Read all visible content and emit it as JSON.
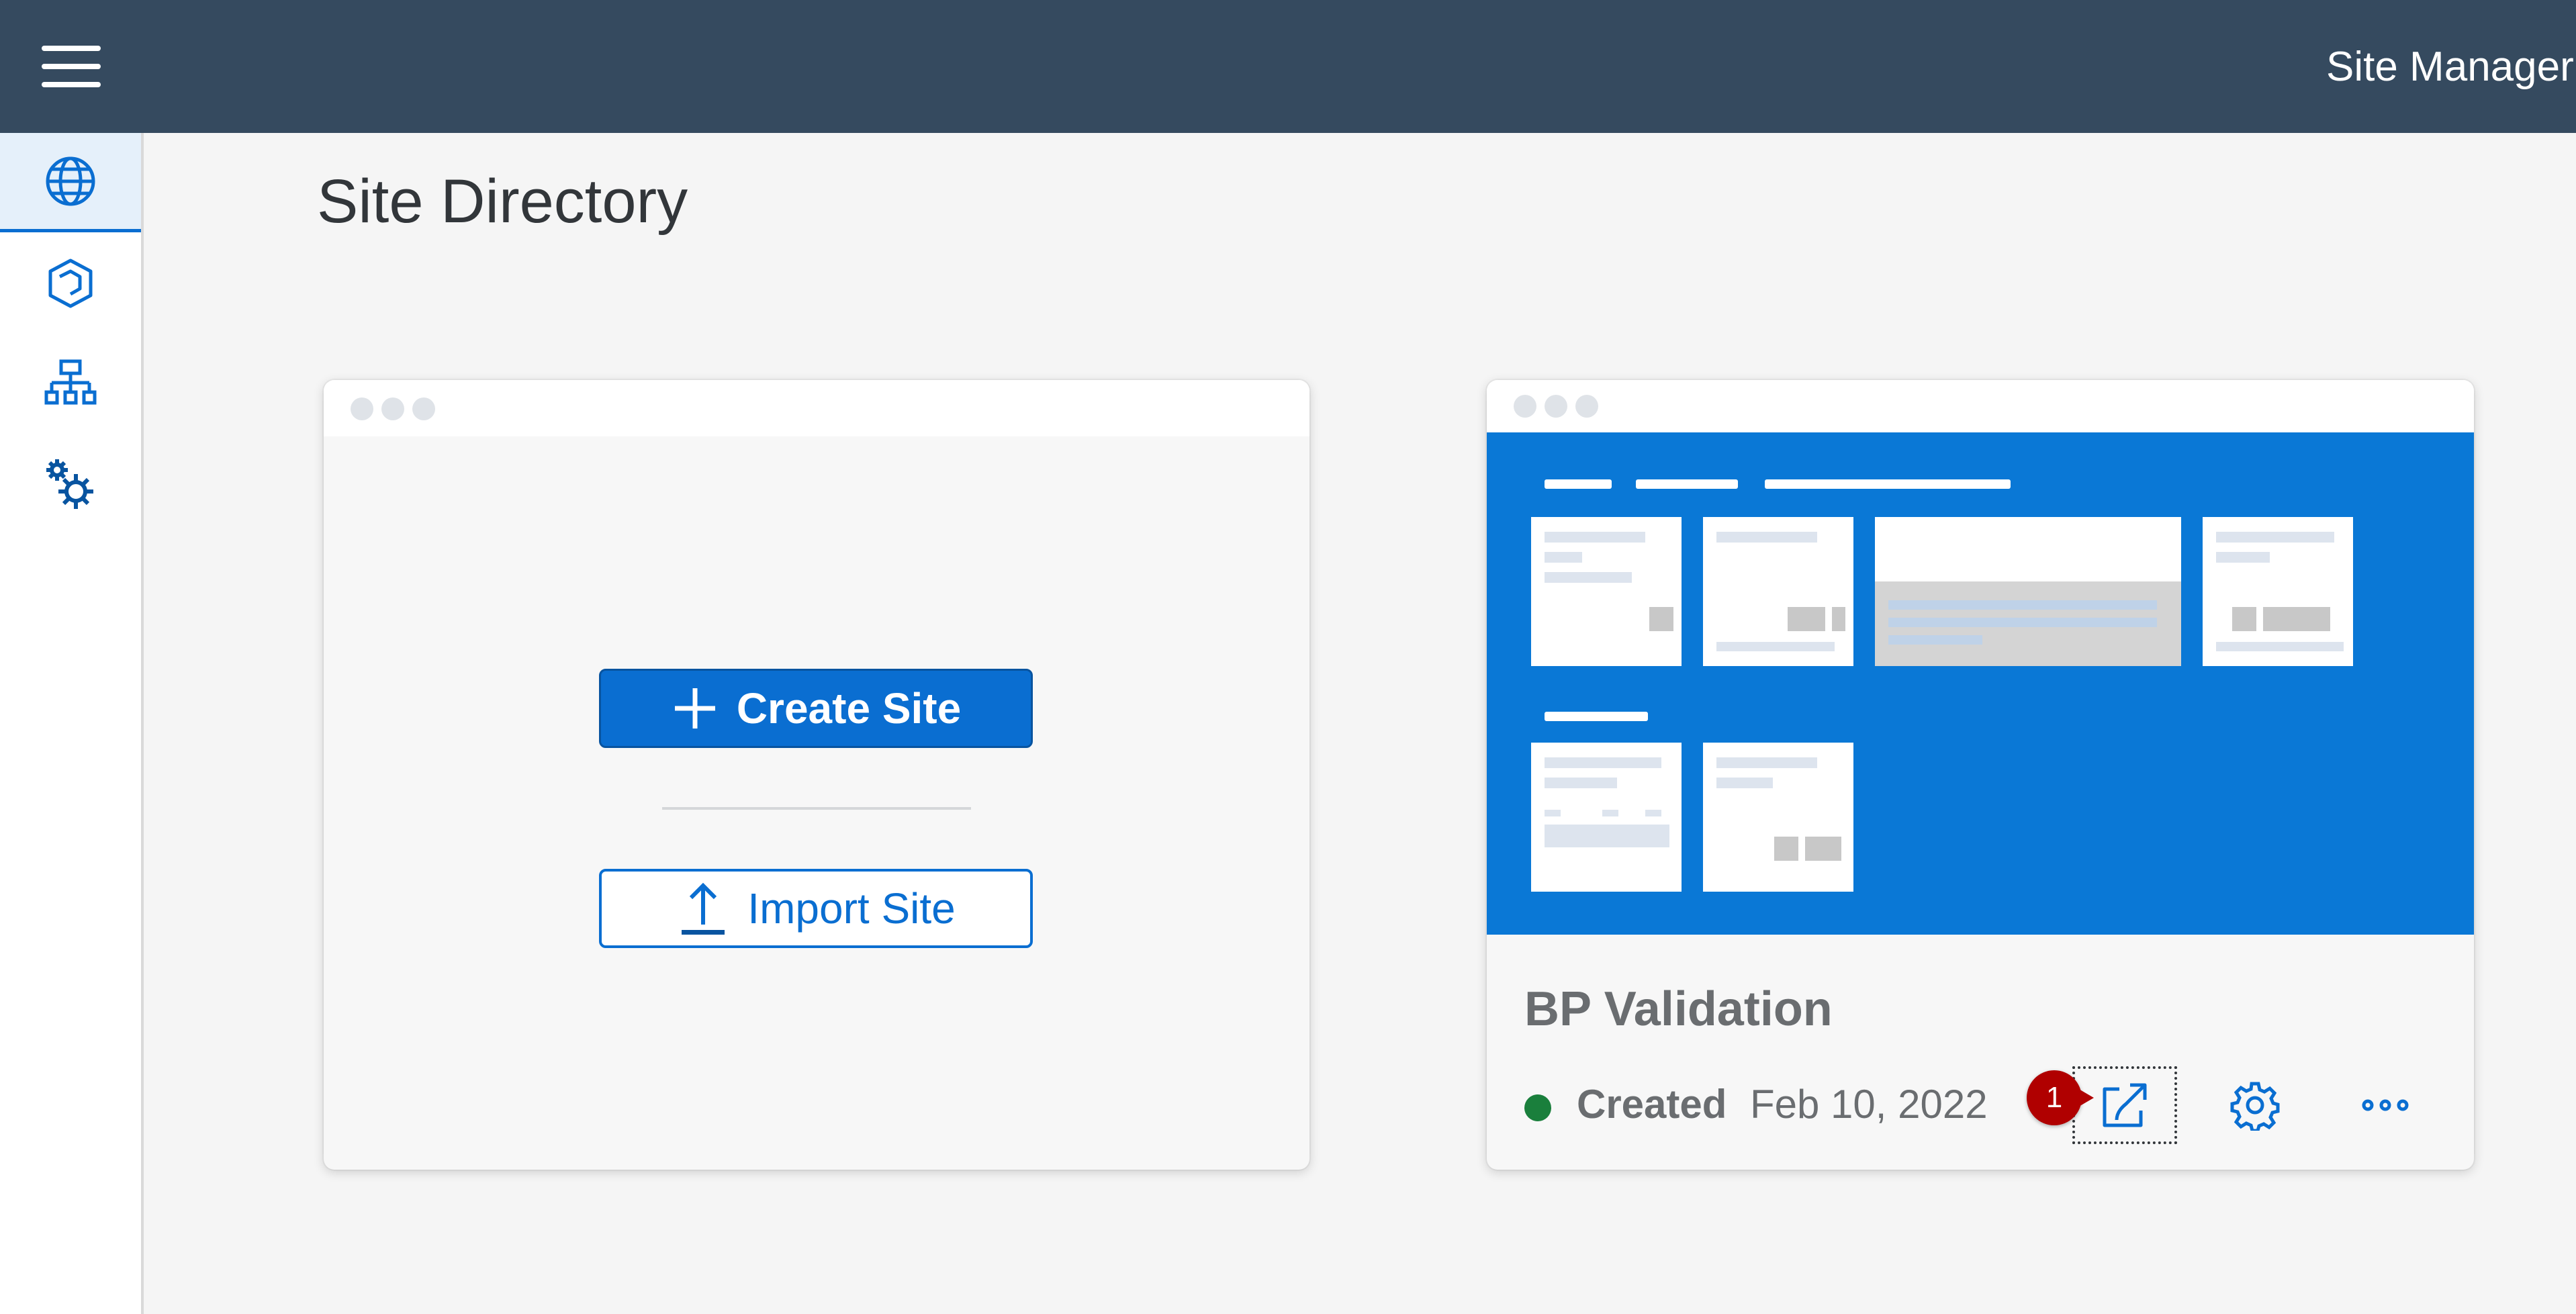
{
  "shellbar": {
    "menu_icon": "hamburger-menu-icon",
    "title": "Site Manager"
  },
  "sidenav": {
    "items": [
      {
        "id": "site-directory",
        "icon": "globe-icon",
        "selected": true
      },
      {
        "id": "content-manager",
        "icon": "cube-icon",
        "selected": false
      },
      {
        "id": "provider-manager",
        "icon": "org-chart-icon",
        "selected": false
      },
      {
        "id": "settings",
        "icon": "gears-icon",
        "selected": false
      }
    ]
  },
  "page": {
    "title": "Site Directory"
  },
  "create_card": {
    "create_label": "Create Site",
    "create_icon": "plus-icon",
    "import_label": "Import Site",
    "import_icon": "upload-icon"
  },
  "site_card": {
    "name": "BP Validation",
    "status": "Created",
    "status_color": "#1a7f3c",
    "date": "Feb 10, 2022",
    "actions": [
      {
        "id": "launch",
        "icon": "launch-icon",
        "focused": true
      },
      {
        "id": "settings",
        "icon": "gear-icon"
      },
      {
        "id": "more",
        "icon": "overflow-icon"
      }
    ]
  },
  "annotation": {
    "step": "1"
  },
  "colors": {
    "shell": "#354a5f",
    "accent": "#0a6ed1",
    "thumbnail": "#0a78d6",
    "badge": "#b00000"
  }
}
